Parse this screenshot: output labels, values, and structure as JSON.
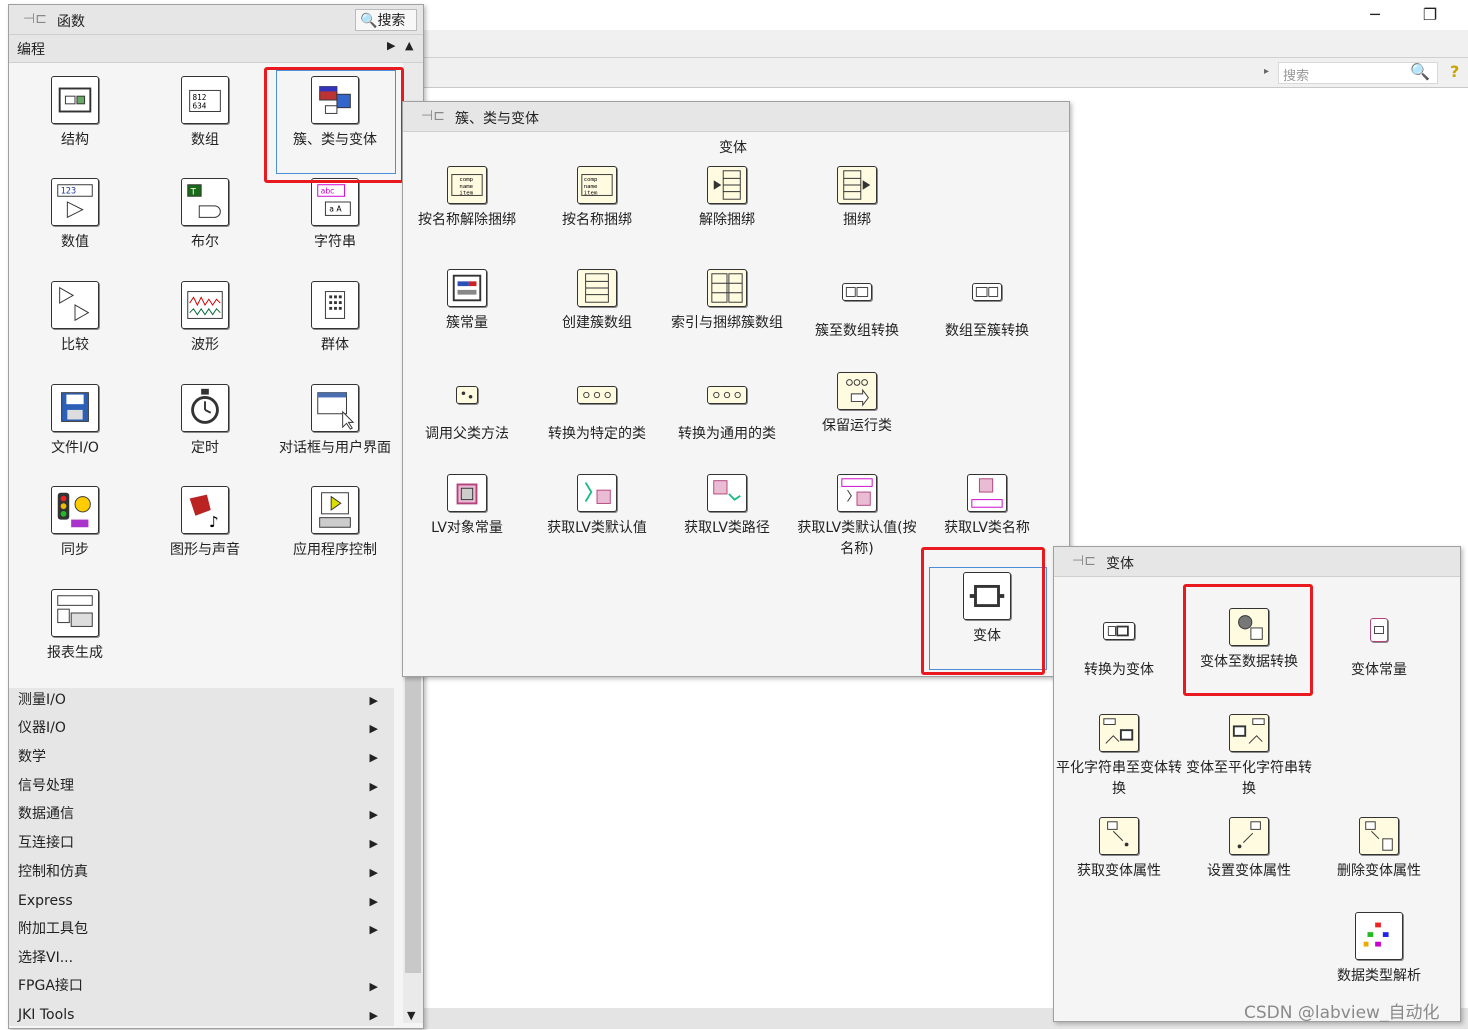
{
  "functions_palette": {
    "title": "函数",
    "search_label": "搜索",
    "top_category": "编程",
    "items": [
      {
        "label": "结构"
      },
      {
        "label": "数组"
      },
      {
        "label": "簇、类与变体"
      },
      {
        "label": "数值"
      },
      {
        "label": "布尔"
      },
      {
        "label": "字符串"
      },
      {
        "label": "比较"
      },
      {
        "label": "波形"
      },
      {
        "label": "群体"
      },
      {
        "label": "文件I/O"
      },
      {
        "label": "定时"
      },
      {
        "label": "对话框与用户界面"
      },
      {
        "label": "同步"
      },
      {
        "label": "图形与声音"
      },
      {
        "label": "应用程序控制"
      },
      {
        "label": "报表生成"
      }
    ],
    "categories": [
      {
        "label": "测量I/O"
      },
      {
        "label": "仪器I/O"
      },
      {
        "label": "数学"
      },
      {
        "label": "信号处理"
      },
      {
        "label": "数据通信"
      },
      {
        "label": "互连接口"
      },
      {
        "label": "控制和仿真"
      },
      {
        "label": "Express"
      },
      {
        "label": "附加工具包"
      },
      {
        "label": "选择VI..."
      },
      {
        "label": "FPGA接口"
      },
      {
        "label": "JKI Tools"
      }
    ]
  },
  "cluster_palette": {
    "title": "簇、类与变体",
    "section_label": "变体",
    "items": [
      {
        "label": "按名称解除捆绑"
      },
      {
        "label": "按名称捆绑"
      },
      {
        "label": "解除捆绑"
      },
      {
        "label": "捆绑"
      },
      {
        "label": "簇常量"
      },
      {
        "label": "创建簇数组"
      },
      {
        "label": "索引与捆绑簇数组"
      },
      {
        "label": "簇至数组转换"
      },
      {
        "label": "数组至簇转换"
      },
      {
        "label": "调用父类方法"
      },
      {
        "label": "转换为特定的类"
      },
      {
        "label": "转换为通用的类"
      },
      {
        "label": "保留运行类"
      },
      {
        "label": "LV对象常量"
      },
      {
        "label": "获取LV类默认值"
      },
      {
        "label": "获取LV类路径"
      },
      {
        "label": "获取LV类默认值(按名称)"
      },
      {
        "label": "获取LV类名称"
      },
      {
        "label": "变体"
      }
    ]
  },
  "variant_palette": {
    "title": "变体",
    "items": [
      {
        "label": "转换为变体"
      },
      {
        "label": "变体至数据转换"
      },
      {
        "label": "变体常量"
      },
      {
        "label": "平化字符串至变体转换"
      },
      {
        "label": "变体至平化字符串转换"
      },
      {
        "label": "获取变体属性"
      },
      {
        "label": "设置变体属性"
      },
      {
        "label": "删除变体属性"
      },
      {
        "label": "数据类型解析"
      }
    ]
  },
  "background_window": {
    "search_placeholder": "搜索",
    "help_glyph": "?"
  },
  "watermark": "CSDN @labview_自动化",
  "colors": {
    "highlight": "#e8191f",
    "selection": "#4a90d9"
  }
}
